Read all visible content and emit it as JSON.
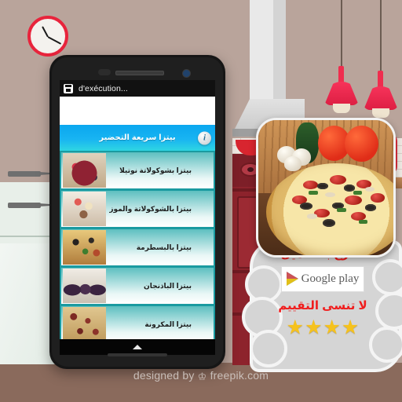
{
  "scene": {
    "background_color": "#b9a49b",
    "floor_color": "#8a6a5c",
    "accent_red": "#e8243c",
    "stove_color": "#8d232c"
  },
  "clock": {
    "name": "wall-clock",
    "time": "2:05"
  },
  "phone": {
    "titlebar": {
      "app_icon": "app-jar-icon",
      "title": "d'exécution..."
    },
    "ad_band": {
      "label": ""
    },
    "section_header": {
      "title": "بيتزا سريعة التحضير",
      "info_icon": "i",
      "background_start": "#0aa7ef",
      "background_end": "#2fd6e2"
    },
    "list_items": [
      {
        "label": "بيتزا بشوكولاتة نوتيلا",
        "thumb": "berry-tart-thumb"
      },
      {
        "label": "بيتزا بالشوكولاتة والموز",
        "thumb": "banana-chocolate-pizza-thumb"
      },
      {
        "label": "بيتزا بالبسطرمة",
        "thumb": "pastrami-pizza-thumb"
      },
      {
        "label": "بيتزا الباذنجان",
        "thumb": "eggplant-pizza-thumb"
      },
      {
        "label": "بيتزا المكرونة",
        "thumb": "macaroni-pizza-thumb"
      }
    ],
    "navbar": {
      "icon": "chevron-up-icon"
    }
  },
  "promo": {
    "app_icon": "pizza-app-icon",
    "download_text": "سارع  بالتحميل",
    "store_badge": {
      "icon": "google-play-triangle-icon",
      "label": "Google play"
    },
    "rating_text": "لا  تنسى  التقييم",
    "stars": 4,
    "star_glyph": "★",
    "text_color": "#f01d1d"
  },
  "credit": {
    "prefix": "designed by",
    "crown": "♔",
    "site": "freepik.com"
  }
}
